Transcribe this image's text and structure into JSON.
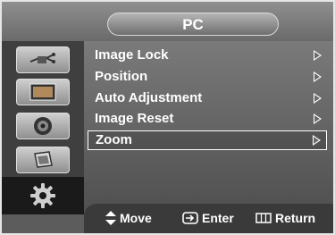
{
  "header": {
    "title": "PC"
  },
  "sidebar": {
    "items": [
      {
        "icon": "plug-icon"
      },
      {
        "icon": "picture-icon"
      },
      {
        "icon": "speaker-icon"
      },
      {
        "icon": "channel-icon"
      },
      {
        "icon": "gear-icon"
      }
    ]
  },
  "menu": {
    "items": [
      {
        "label": "Image Lock"
      },
      {
        "label": "Position"
      },
      {
        "label": "Auto Adjustment"
      },
      {
        "label": "Image Reset"
      },
      {
        "label": "Zoom"
      }
    ],
    "selected": "Zoom"
  },
  "footer": {
    "move_label": "Move",
    "enter_label": "Enter",
    "return_label": "Return"
  },
  "colors": {
    "panel": "#5c5c5c",
    "sidebar": "#3f3f3f",
    "text": "#ffffff"
  }
}
